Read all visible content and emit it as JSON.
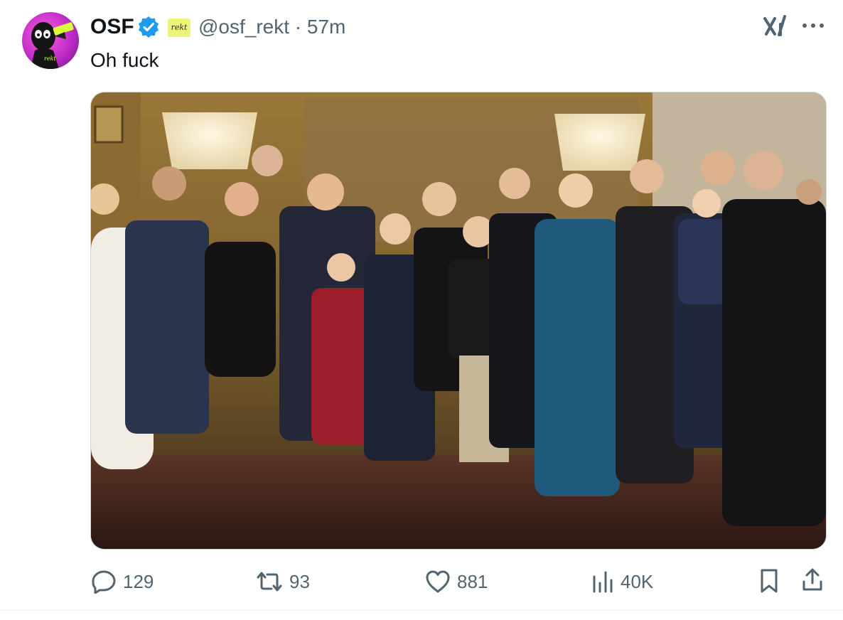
{
  "tweet": {
    "author_name": "OSF",
    "badge_text": "rekt",
    "handle_time": "@osf_rekt · 57m",
    "text": "Oh fuck",
    "avatar_text": "rekt"
  },
  "actions": {
    "replies": "129",
    "reposts": "93",
    "likes": "881",
    "views": "40K"
  },
  "icons": [
    "verified-icon",
    "grok-icon",
    "more-icon",
    "reply-icon",
    "repost-icon",
    "like-icon",
    "views-icon",
    "bookmark-icon",
    "share-icon"
  ],
  "colors": {
    "verified": "#1d9bf0",
    "text_secondary": "#536471",
    "badge_bg": "#ecf57a",
    "avatar": "#d23fd6"
  }
}
